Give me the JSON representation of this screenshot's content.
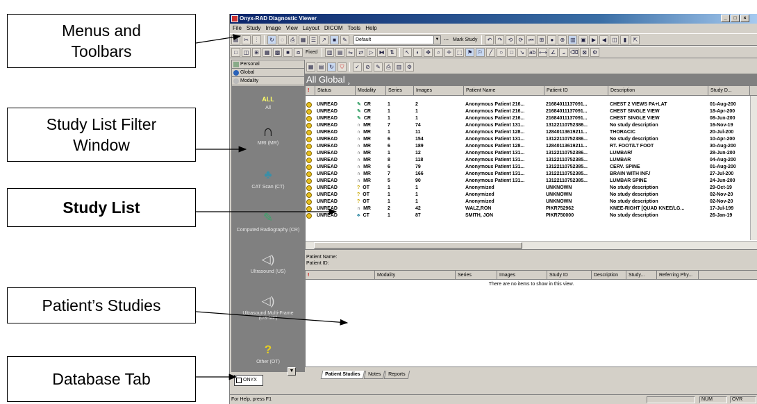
{
  "callouts": {
    "menus": "Menus and Toolbars",
    "filter": "Study List Filter Window",
    "studylist": "Study List",
    "patient": "Patient’s Studies",
    "database": "Database Tab"
  },
  "app": {
    "title": "Onyx-RAD Diagnostic Viewer",
    "menus": [
      "File",
      "Study",
      "Image",
      "View",
      "Layout",
      "DICOM",
      "Tools",
      "Help"
    ],
    "layout_combo": "Default",
    "mark_study": "Mark Study",
    "fixed_combo": "Fixed"
  },
  "nav": {
    "tabs": [
      "Personal",
      "Global",
      "Modality"
    ],
    "modalities": [
      {
        "icon": "all-icon",
        "glyph": "ALL",
        "label": "All"
      },
      {
        "icon": "mri-icon",
        "glyph": "∩",
        "label": "MRI (MR)"
      },
      {
        "icon": "ct-icon",
        "glyph": "♣",
        "label": "CAT Scan (CT)"
      },
      {
        "icon": "cr-icon",
        "glyph": "✎",
        "label": "Computed Radiography (CR)"
      },
      {
        "icon": "ultrasound-icon",
        "glyph": "◁)",
        "label": "Ultrasound (US)"
      },
      {
        "icon": "ultrasound-mf-icon",
        "glyph": "◁)",
        "label": "Ultrasound Multi-Frame (US-MF)"
      },
      {
        "icon": "other-icon",
        "glyph": "?",
        "label": "Other (OT)"
      }
    ]
  },
  "study_list": {
    "header": "All Global",
    "columns": [
      "!",
      "Status",
      "Modality",
      "Series",
      "Images",
      "Patient Name",
      "Patient ID",
      "Description",
      "Study D..."
    ],
    "rows": [
      {
        "status": "UNREAD",
        "mod": "CR",
        "series": "1",
        "images": "2",
        "name": "Anonymous Patient 216...",
        "pid": "21684011137091...",
        "desc": "CHEST 2 VIEWS PA+LAT",
        "date": "01-Aug-200"
      },
      {
        "status": "UNREAD",
        "mod": "CR",
        "series": "1",
        "images": "1",
        "name": "Anonymous Patient 216...",
        "pid": "21684011137091...",
        "desc": "CHEST SINGLE VIEW",
        "date": "18-Apr-200"
      },
      {
        "status": "UNREAD",
        "mod": "CR",
        "series": "1",
        "images": "1",
        "name": "Anonymous Patient 216...",
        "pid": "21684011137091...",
        "desc": "CHEST SINGLE VIEW",
        "date": "08-Jun-200"
      },
      {
        "status": "UNREAD",
        "mod": "MR",
        "series": "7",
        "images": "74",
        "name": "Anonymous Patient 131...",
        "pid": "13122110752386...",
        "desc": "No study description",
        "date": "16-Nov-19"
      },
      {
        "status": "UNREAD",
        "mod": "MR",
        "series": "1",
        "images": "11",
        "name": "Anonymous Patient 128...",
        "pid": "12840113619211...",
        "desc": "THORACIC",
        "date": "20-Jul-200"
      },
      {
        "status": "UNREAD",
        "mod": "MR",
        "series": "6",
        "images": "154",
        "name": "Anonymous Patient 131...",
        "pid": "13122110752386...",
        "desc": "No study description",
        "date": "10-Apr-200"
      },
      {
        "status": "UNREAD",
        "mod": "MR",
        "series": "6",
        "images": "189",
        "name": "Anonymous Patient 128...",
        "pid": "12840113619211...",
        "desc": "RT. FOOT/LT FOOT",
        "date": "30-Aug-200"
      },
      {
        "status": "UNREAD",
        "mod": "MR",
        "series": "1",
        "images": "12",
        "name": "Anonymous Patient 131...",
        "pid": "13122110752386...",
        "desc": "LUMBAR/",
        "date": "28-Jun-200"
      },
      {
        "status": "UNREAD",
        "mod": "MR",
        "series": "8",
        "images": "118",
        "name": "Anonymous Patient 131...",
        "pid": "13122110752385...",
        "desc": "LUMBAR",
        "date": "04-Aug-200"
      },
      {
        "status": "UNREAD",
        "mod": "MR",
        "series": "6",
        "images": "79",
        "name": "Anonymous Patient 131...",
        "pid": "13122110752385...",
        "desc": "CERV. SPINE",
        "date": "01-Aug-200"
      },
      {
        "status": "UNREAD",
        "mod": "MR",
        "series": "7",
        "images": "166",
        "name": "Anonymous Patient 131...",
        "pid": "13122110752385...",
        "desc": "BRAIN WITH INF./",
        "date": "27-Jul-200"
      },
      {
        "status": "UNREAD",
        "mod": "MR",
        "series": "5",
        "images": "90",
        "name": "Anonymous Patient 131...",
        "pid": "13122110752385...",
        "desc": "LUMBAR SPINE",
        "date": "24-Jun-200"
      },
      {
        "status": "UNREAD",
        "mod": "OT",
        "series": "1",
        "images": "1",
        "name": "Anonymized",
        "pid": "UNKNOWN",
        "desc": "No study description",
        "date": "29-Oct-19"
      },
      {
        "status": "UNREAD",
        "mod": "OT",
        "series": "1",
        "images": "1",
        "name": "Anonymized",
        "pid": "UNKNOWN",
        "desc": "No study description",
        "date": "02-Nov-20"
      },
      {
        "status": "UNREAD",
        "mod": "OT",
        "series": "1",
        "images": "1",
        "name": "Anonymized",
        "pid": "UNKNOWN",
        "desc": "No study description",
        "date": "02-Nov-20"
      },
      {
        "status": "UNREAD",
        "mod": "MR",
        "series": "2",
        "images": "42",
        "name": "WALZ,RON",
        "pid": "PIKR752962",
        "desc": "KNEE-RIGHT [QUAD KNEE/LG...",
        "date": "17-Jul-199"
      },
      {
        "status": "UNREAD",
        "mod": "CT",
        "series": "1",
        "images": "87",
        "name": "SMITH, JON",
        "pid": "PIKR750000",
        "desc": "No study description",
        "date": "26-Jan-19"
      }
    ]
  },
  "patient": {
    "name_label": "Patient Name:",
    "id_label": "Patient ID:",
    "columns": [
      "!",
      "Modality",
      "Series",
      "Images",
      "Study ID",
      "Description",
      "Study...",
      "Referring Phy..."
    ],
    "empty_text": "There are no items to show in this view.",
    "tabs": [
      "Patient Studies",
      "Notes",
      "Reports"
    ]
  },
  "database_tab": "ONYX",
  "status": {
    "help": "For Help, press F1",
    "num": "NUM",
    "ovr": "OVR"
  }
}
